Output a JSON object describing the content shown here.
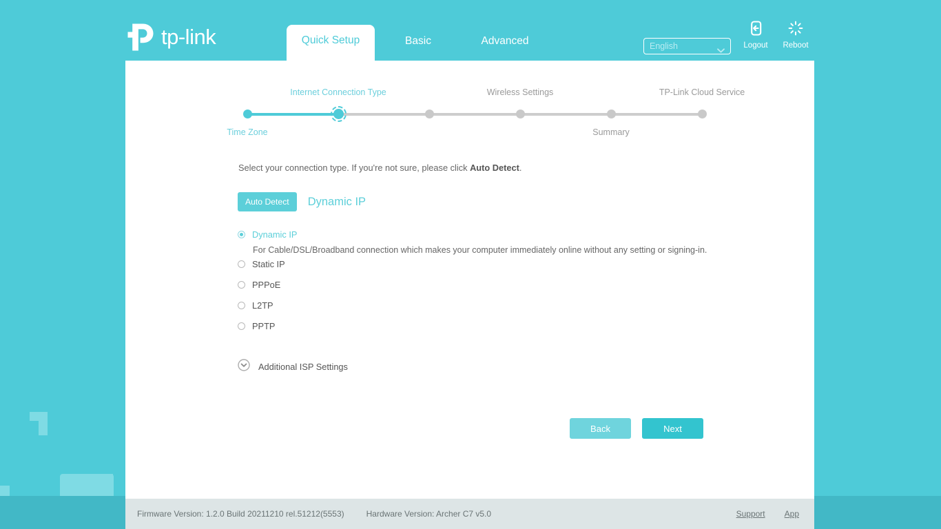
{
  "brand": {
    "logo_text": "tp-link",
    "logo_icon": "tp-link-logo-icon"
  },
  "header": {
    "tabs": [
      {
        "label": "Quick Setup",
        "active": true
      },
      {
        "label": "Basic",
        "active": false
      },
      {
        "label": "Advanced",
        "active": false
      }
    ],
    "language": {
      "selected": "English",
      "options": [
        "English"
      ]
    },
    "logout_label": "Logout",
    "reboot_label": "Reboot"
  },
  "steps": {
    "items": [
      {
        "label": "Time Zone",
        "position": "below",
        "state": "done"
      },
      {
        "label": "Internet Connection Type",
        "position": "above",
        "state": "current"
      },
      {
        "label": "Wireless Settings",
        "position": "above",
        "state": "pending"
      },
      {
        "label": "",
        "position": "none",
        "state": "pending"
      },
      {
        "label": "Summary",
        "position": "below",
        "state": "pending"
      },
      {
        "label": "TP-Link Cloud Service",
        "position": "above",
        "state": "pending"
      }
    ]
  },
  "main": {
    "intro_prefix": "Select your connection type. If you're not sure, please click ",
    "intro_strong": "Auto Detect",
    "intro_suffix": ".",
    "auto_detect_label": "Auto Detect",
    "detected_type": "Dynamic IP",
    "connection_types": [
      {
        "label": "Dynamic IP",
        "selected": true,
        "description": "For Cable/DSL/Broadband connection which makes your computer immediately online without any setting or signing-in."
      },
      {
        "label": "Static IP",
        "selected": false,
        "description": ""
      },
      {
        "label": "PPPoE",
        "selected": false,
        "description": ""
      },
      {
        "label": "L2TP",
        "selected": false,
        "description": ""
      },
      {
        "label": "PPTP",
        "selected": false,
        "description": ""
      }
    ],
    "isp_settings_label": "Additional ISP Settings",
    "back_label": "Back",
    "next_label": "Next"
  },
  "footer": {
    "firmware": "Firmware Version: 1.2.0 Build 20211210 rel.51212(5553)",
    "hardware": "Hardware Version: Archer C7 v5.0",
    "support_label": "Support",
    "app_label": "App"
  },
  "colors": {
    "brand_teal": "#4ecbd8",
    "accent_teal": "#5ccfd9",
    "next_teal": "#33c4cf",
    "back_teal": "#6fd4dd",
    "footer_bg": "#dde5e6",
    "muted_text": "#9a9a9a"
  }
}
